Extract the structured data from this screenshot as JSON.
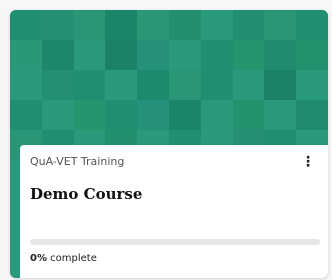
{
  "card": {
    "category": "QuA-VET Training",
    "title": "Demo Course",
    "menu_icon": "more-vertical-icon",
    "progress_value": "0%",
    "progress_label": " complete",
    "progress_fraction": 0
  },
  "colors": {
    "accent": "#2a9a7c",
    "pattern": [
      "#1f8e71",
      "#248f73",
      "#2a9678",
      "#1b856a",
      "#2b9779",
      "#22906f",
      "#2a9a7c",
      "#218d71",
      "#2a9678",
      "#1f8e71",
      "#289878",
      "#1e866a",
      "#2a9a7c",
      "#1b8268",
      "#25917a",
      "#2a9a7c",
      "#1f8e71",
      "#24956f",
      "#208b6f",
      "#23926f",
      "#2a9a7c",
      "#238f74",
      "#1f8e71",
      "#2a9a7c",
      "#1c8a6d",
      "#2a9678",
      "#1f8e71",
      "#2a9a7c",
      "#1b8268",
      "#2a9a7c",
      "#1f8e71",
      "#2a9a7c",
      "#24956f",
      "#1f8e71",
      "#25917a",
      "#1b856a",
      "#2a9a7c",
      "#23926f",
      "#2a9a7c",
      "#208b6f",
      "#2a9678",
      "#1f8e71",
      "#2a9a7c",
      "#22906f",
      "#2a9a7c",
      "#1f8e71",
      "#2a9a7c",
      "#248f73",
      "#1f8e71",
      "#2a9a7c"
    ]
  }
}
